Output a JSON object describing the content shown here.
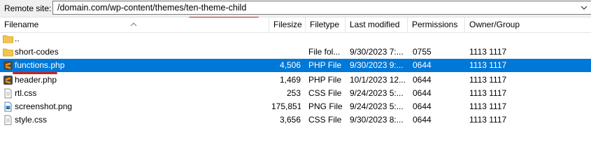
{
  "site_bar": {
    "label": "Remote site:",
    "path_prefix": "/domain.com/wp-content/themes/",
    "path_highlight": "ten-theme-child"
  },
  "columns": {
    "filename": "Filename",
    "filesize": "Filesize",
    "filetype": "Filetype",
    "last_modified": "Last modified",
    "permissions": "Permissions",
    "owner_group": "Owner/Group"
  },
  "files": [
    {
      "name": "..",
      "size": "",
      "type": "",
      "modified": "",
      "permissions": "",
      "owner": "",
      "icon": "folder-icon"
    },
    {
      "name": "short-codes",
      "size": "",
      "type": "File fol...",
      "modified": "9/30/2023 7:...",
      "permissions": "0755",
      "owner": "1113 1117",
      "icon": "folder-icon"
    },
    {
      "name": "functions.php",
      "size": "4,506",
      "type": "PHP File",
      "modified": "9/30/2023 9:...",
      "permissions": "0644",
      "owner": "1113 1117",
      "icon": "sublime-file-icon"
    },
    {
      "name": "header.php",
      "size": "1,469",
      "type": "PHP File",
      "modified": "10/1/2023 12...",
      "permissions": "0644",
      "owner": "1113 1117",
      "icon": "sublime-file-icon"
    },
    {
      "name": "rtl.css",
      "size": "253",
      "type": "CSS File",
      "modified": "9/24/2023 5:...",
      "permissions": "0644",
      "owner": "1113 1117",
      "icon": "text-file-icon"
    },
    {
      "name": "screenshot.png",
      "size": "175,851",
      "type": "PNG File",
      "modified": "9/24/2023 5:...",
      "permissions": "0644",
      "owner": "1113 1117",
      "icon": "image-file-icon"
    },
    {
      "name": "style.css",
      "size": "3,656",
      "type": "CSS File",
      "modified": "9/30/2023 8:...",
      "permissions": "0644",
      "owner": "1113 1117",
      "icon": "text-file-icon"
    }
  ],
  "selected_file": "functions.php",
  "colors": {
    "selection": "#0078d7",
    "annotation_underline": "#cc1f1f",
    "folder": "#f3c64f"
  }
}
